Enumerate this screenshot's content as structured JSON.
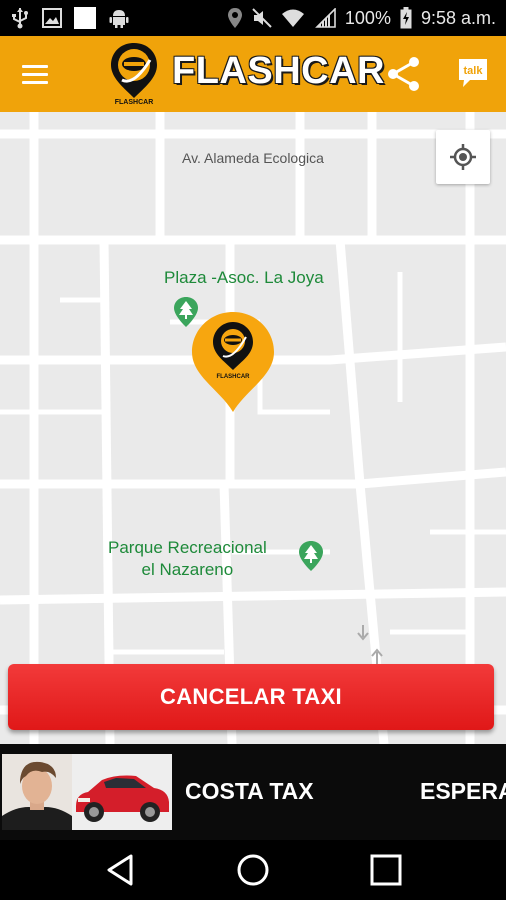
{
  "status_bar": {
    "battery": "100%",
    "time": "9:58 a.m."
  },
  "app_bar": {
    "title": "FLASHCAR",
    "logo_text": "FLASHCAR",
    "talk_label": "talk"
  },
  "map": {
    "street_label": "Av. Alameda Ecologica",
    "poi1": "Plaza -Asoc. La Joya",
    "poi2_line1": "Parque Recreacional",
    "poi2_line2": "el Nazareno",
    "marker_text": "FLASHCAR"
  },
  "cancel_button": {
    "label": "CANCELAR TAXI"
  },
  "driver": {
    "name": "COSTA TAX",
    "status": "ESPERA"
  },
  "colors": {
    "brand": "#F0A30A",
    "cancel": "#E82828",
    "poi": "#1E8A3A"
  },
  "icons": [
    "usb-icon",
    "image-icon",
    "android-icon",
    "location-icon",
    "mute-icon",
    "wifi-icon",
    "signal-icon",
    "battery-icon",
    "menu-icon",
    "share-icon",
    "talk-icon",
    "locate-icon",
    "tree-icon",
    "back-icon",
    "home-icon",
    "recents-icon"
  ]
}
